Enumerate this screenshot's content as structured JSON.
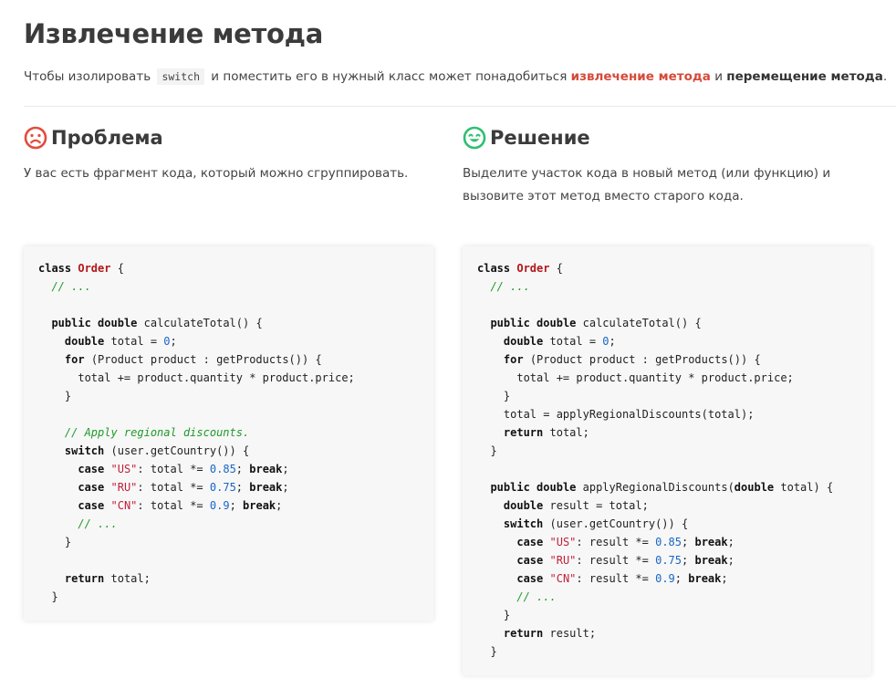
{
  "title": "Извлечение метода",
  "intro": {
    "before_code": "Чтобы изолировать",
    "code": "switch",
    "middle": "и поместить его в нужный класс может понадобиться",
    "link": "извлечение метода",
    "conj": "и",
    "bold": "перемещение метода",
    "end": "."
  },
  "problem": {
    "heading": "Проблема",
    "description": "У вас есть фрагмент кода, который можно сгруппировать.",
    "icon": "sad-face-icon",
    "icon_color": "#e24c3c"
  },
  "solution": {
    "heading": "Решение",
    "description_line1": "Выделите участок кода в новый метод (или функцию) и",
    "description_line2": "вызовите этот метод вместо старого кода.",
    "icon": "happy-face-icon",
    "icon_color": "#2fbf71"
  },
  "code_before": [
    [
      [
        "kw",
        "class"
      ],
      [
        "t",
        " "
      ],
      [
        "cls",
        "Order"
      ],
      [
        "t",
        " {"
      ]
    ],
    [
      [
        "t",
        "  "
      ],
      [
        "cm",
        "// ..."
      ]
    ],
    [],
    [
      [
        "t",
        "  "
      ],
      [
        "kw",
        "public"
      ],
      [
        "t",
        " "
      ],
      [
        "kw",
        "double"
      ],
      [
        "t",
        " calculateTotal() {"
      ]
    ],
    [
      [
        "t",
        "    "
      ],
      [
        "kw",
        "double"
      ],
      [
        "t",
        " total = "
      ],
      [
        "num",
        "0"
      ],
      [
        "t",
        ";"
      ]
    ],
    [
      [
        "t",
        "    "
      ],
      [
        "kw",
        "for"
      ],
      [
        "t",
        " (Product product : getProducts()) {"
      ]
    ],
    [
      [
        "t",
        "      total += product.quantity * product.price;"
      ]
    ],
    [
      [
        "t",
        "    }"
      ]
    ],
    [],
    [
      [
        "t",
        "    "
      ],
      [
        "cm",
        "// Apply regional discounts."
      ]
    ],
    [
      [
        "t",
        "    "
      ],
      [
        "kw",
        "switch"
      ],
      [
        "t",
        " (user.getCountry()) {"
      ]
    ],
    [
      [
        "t",
        "      "
      ],
      [
        "kw",
        "case"
      ],
      [
        "t",
        " "
      ],
      [
        "str",
        "\"US\""
      ],
      [
        "t",
        ": total *= "
      ],
      [
        "num",
        "0.85"
      ],
      [
        "t",
        "; "
      ],
      [
        "kw",
        "break"
      ],
      [
        "t",
        ";"
      ]
    ],
    [
      [
        "t",
        "      "
      ],
      [
        "kw",
        "case"
      ],
      [
        "t",
        " "
      ],
      [
        "str",
        "\"RU\""
      ],
      [
        "t",
        ": total *= "
      ],
      [
        "num",
        "0.75"
      ],
      [
        "t",
        "; "
      ],
      [
        "kw",
        "break"
      ],
      [
        "t",
        ";"
      ]
    ],
    [
      [
        "t",
        "      "
      ],
      [
        "kw",
        "case"
      ],
      [
        "t",
        " "
      ],
      [
        "str",
        "\"CN\""
      ],
      [
        "t",
        ": total *= "
      ],
      [
        "num",
        "0.9"
      ],
      [
        "t",
        "; "
      ],
      [
        "kw",
        "break"
      ],
      [
        "t",
        ";"
      ]
    ],
    [
      [
        "t",
        "      "
      ],
      [
        "cm",
        "// ..."
      ]
    ],
    [
      [
        "t",
        "    }"
      ]
    ],
    [],
    [
      [
        "t",
        "    "
      ],
      [
        "kw",
        "return"
      ],
      [
        "t",
        " total;"
      ]
    ],
    [
      [
        "t",
        "  }"
      ]
    ]
  ],
  "code_after": [
    [
      [
        "kw",
        "class"
      ],
      [
        "t",
        " "
      ],
      [
        "cls",
        "Order"
      ],
      [
        "t",
        " {"
      ]
    ],
    [
      [
        "t",
        "  "
      ],
      [
        "cm",
        "// ..."
      ]
    ],
    [],
    [
      [
        "t",
        "  "
      ],
      [
        "kw",
        "public"
      ],
      [
        "t",
        " "
      ],
      [
        "kw",
        "double"
      ],
      [
        "t",
        " calculateTotal() {"
      ]
    ],
    [
      [
        "t",
        "    "
      ],
      [
        "kw",
        "double"
      ],
      [
        "t",
        " total = "
      ],
      [
        "num",
        "0"
      ],
      [
        "t",
        ";"
      ]
    ],
    [
      [
        "t",
        "    "
      ],
      [
        "kw",
        "for"
      ],
      [
        "t",
        " (Product product : getProducts()) {"
      ]
    ],
    [
      [
        "t",
        "      total += product.quantity * product.price;"
      ]
    ],
    [
      [
        "t",
        "    }"
      ]
    ],
    [
      [
        "t",
        "    total = applyRegionalDiscounts(total);"
      ]
    ],
    [
      [
        "t",
        "    "
      ],
      [
        "kw",
        "return"
      ],
      [
        "t",
        " total;"
      ]
    ],
    [
      [
        "t",
        "  }"
      ]
    ],
    [],
    [
      [
        "t",
        "  "
      ],
      [
        "kw",
        "public"
      ],
      [
        "t",
        " "
      ],
      [
        "kw",
        "double"
      ],
      [
        "t",
        " applyRegionalDiscounts("
      ],
      [
        "kw",
        "double"
      ],
      [
        "t",
        " total) {"
      ]
    ],
    [
      [
        "t",
        "    "
      ],
      [
        "kw",
        "double"
      ],
      [
        "t",
        " result = total;"
      ]
    ],
    [
      [
        "t",
        "    "
      ],
      [
        "kw",
        "switch"
      ],
      [
        "t",
        " (user.getCountry()) {"
      ]
    ],
    [
      [
        "t",
        "      "
      ],
      [
        "kw",
        "case"
      ],
      [
        "t",
        " "
      ],
      [
        "str",
        "\"US\""
      ],
      [
        "t",
        ": result *= "
      ],
      [
        "num",
        "0.85"
      ],
      [
        "t",
        "; "
      ],
      [
        "kw",
        "break"
      ],
      [
        "t",
        ";"
      ]
    ],
    [
      [
        "t",
        "      "
      ],
      [
        "kw",
        "case"
      ],
      [
        "t",
        " "
      ],
      [
        "str",
        "\"RU\""
      ],
      [
        "t",
        ": result *= "
      ],
      [
        "num",
        "0.75"
      ],
      [
        "t",
        "; "
      ],
      [
        "kw",
        "break"
      ],
      [
        "t",
        ";"
      ]
    ],
    [
      [
        "t",
        "      "
      ],
      [
        "kw",
        "case"
      ],
      [
        "t",
        " "
      ],
      [
        "str",
        "\"CN\""
      ],
      [
        "t",
        ": result *= "
      ],
      [
        "num",
        "0.9"
      ],
      [
        "t",
        "; "
      ],
      [
        "kw",
        "break"
      ],
      [
        "t",
        ";"
      ]
    ],
    [
      [
        "t",
        "      "
      ],
      [
        "cm",
        "// ..."
      ]
    ],
    [
      [
        "t",
        "    }"
      ]
    ],
    [
      [
        "t",
        "    "
      ],
      [
        "kw",
        "return"
      ],
      [
        "t",
        " result;"
      ]
    ],
    [
      [
        "t",
        "  }"
      ]
    ]
  ]
}
